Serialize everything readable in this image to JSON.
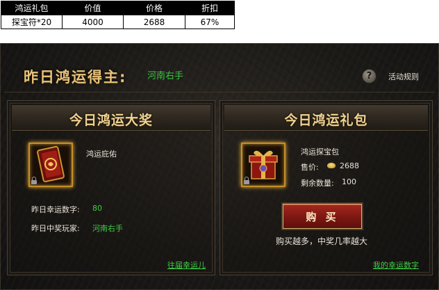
{
  "spec_table": {
    "headers": [
      "鸿运礼包",
      "价值",
      "价格",
      "折扣"
    ],
    "row": [
      "探宝符*20",
      "4000",
      "2688",
      "67%"
    ]
  },
  "header": {
    "title": "昨日鸿运得主:",
    "winner": "河南右手",
    "help_label": "活动规则",
    "help_icon": "?"
  },
  "left_card": {
    "title": "今日鸿运大奖",
    "item_name": "鸿运庇佑",
    "item_icon": "talisman-card-icon",
    "lucky_number_label": "昨日幸运数字:",
    "lucky_number_value": "80",
    "winner_label": "昨日中奖玩家:",
    "winner_value": "河南右手",
    "history_link": "往届幸运儿"
  },
  "right_card": {
    "title": "今日鸿运礼包",
    "item_name": "鸿运探宝包",
    "item_icon": "gift-box-icon",
    "price_label": "售价:",
    "price_value": "2688",
    "price_icon": "gold-ingot-icon",
    "remaining_label": "剩余数量:",
    "remaining_value": "100",
    "buy_button": "购 买",
    "hint": "购买越多，中奖几率越大",
    "my_numbers_link": "我的幸运数字"
  },
  "colors": {
    "panel_bg": "#1c1a17",
    "title_gold": "#f0d292",
    "accent_green": "#3fcf44",
    "button_red": "#7c1712",
    "frame_gold": "#c28f2c"
  }
}
